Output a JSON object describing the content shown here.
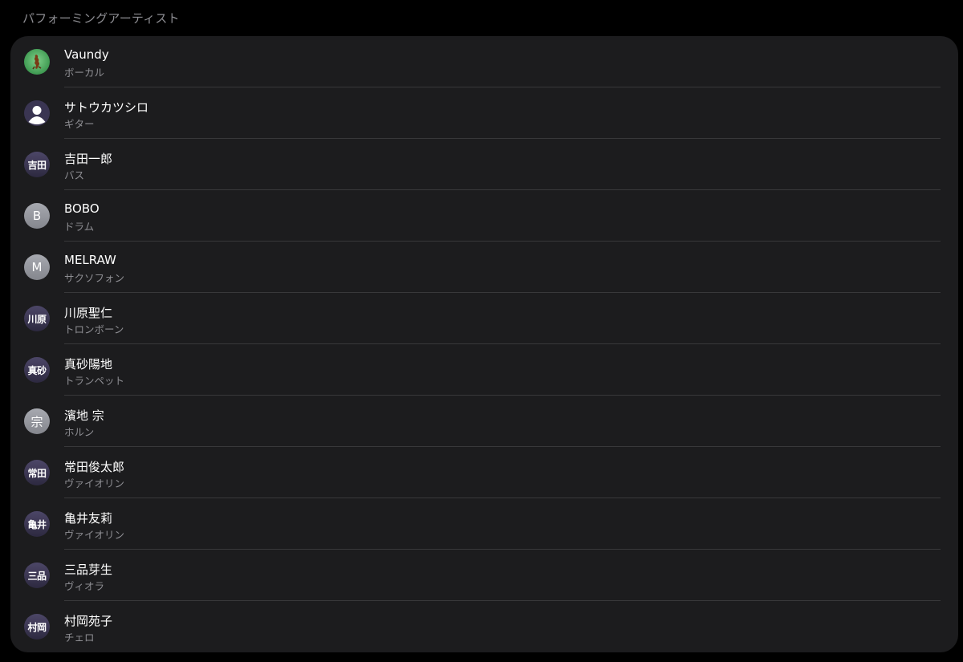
{
  "section": {
    "title": "パフォーミングアーティスト"
  },
  "artists": [
    {
      "name": "Vaundy",
      "role": "ボーカル",
      "avatar_type": "photo",
      "avatar_text": ""
    },
    {
      "name": "サトウカツシロ",
      "role": "ギター",
      "avatar_type": "person",
      "avatar_text": ""
    },
    {
      "name": "吉田一郎",
      "role": "バス",
      "avatar_type": "kanji",
      "avatar_text": "吉田"
    },
    {
      "name": "BOBO",
      "role": "ドラム",
      "avatar_type": "letter",
      "avatar_text": "B"
    },
    {
      "name": "MELRAW",
      "role": "サクソフォン",
      "avatar_type": "letter",
      "avatar_text": "M"
    },
    {
      "name": "川原聖仁",
      "role": "トロンボーン",
      "avatar_type": "kanji",
      "avatar_text": "川原"
    },
    {
      "name": "真砂陽地",
      "role": "トランペット",
      "avatar_type": "kanji",
      "avatar_text": "真砂"
    },
    {
      "name": "濱地 宗",
      "role": "ホルン",
      "avatar_type": "letter",
      "avatar_text": "宗"
    },
    {
      "name": "常田俊太郎",
      "role": "ヴァイオリン",
      "avatar_type": "kanji",
      "avatar_text": "常田"
    },
    {
      "name": "亀井友莉",
      "role": "ヴァイオリン",
      "avatar_type": "kanji",
      "avatar_text": "亀井"
    },
    {
      "name": "三品芽生",
      "role": "ヴィオラ",
      "avatar_type": "kanji",
      "avatar_text": "三品"
    },
    {
      "name": "村岡苑子",
      "role": "チェロ",
      "avatar_type": "kanji",
      "avatar_text": "村岡"
    }
  ],
  "colors": {
    "background": "#000000",
    "card": "#1c1c1e",
    "divider": "#38383a",
    "secondary_text": "#8e8e93"
  }
}
